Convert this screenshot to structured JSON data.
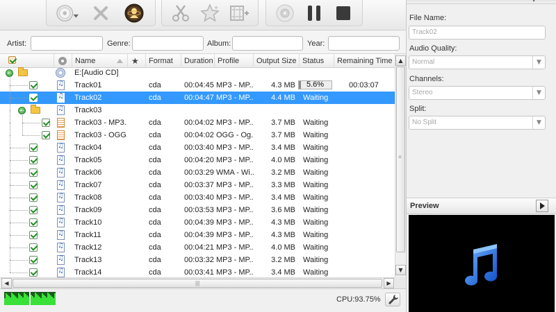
{
  "toolbar": {
    "groups": [
      {
        "buttons": [
          "cd-load-icon",
          "remove-icon",
          "profile-icon"
        ]
      },
      {
        "buttons": [
          "trim-icon",
          "effect-icon",
          "merge-icon"
        ]
      },
      {
        "buttons": [
          "snapshot-icon",
          "pause-icon",
          "stop-icon"
        ]
      }
    ]
  },
  "filters": {
    "artist_label": "Artist:",
    "artist_value": "",
    "genre_label": "Genre:",
    "genre_value": "",
    "album_label": "Album:",
    "album_value": "",
    "year_label": "Year:",
    "year_value": ""
  },
  "columns": {
    "name": "Name",
    "format": "Format",
    "duration": "Duration",
    "profile": "Profile",
    "output_size": "Output Size",
    "status": "Status",
    "remaining": "Remaining Time"
  },
  "rows": [
    {
      "kind": "disc",
      "name": "E:[Audio CD]"
    },
    {
      "kind": "track",
      "name": "Track01",
      "format": "cda",
      "duration": "00:04:45",
      "profile": "MP3 - MP...",
      "size": "4.3 MB",
      "status": "5.6%",
      "progress": 0.056,
      "remaining": "00:03:07"
    },
    {
      "kind": "track",
      "name": "Track02",
      "format": "cda",
      "duration": "00:04:47",
      "profile": "MP3 - MP...",
      "size": "4.4 MB",
      "status": "Waiting",
      "remaining": "",
      "selected": true
    },
    {
      "kind": "folder",
      "name": "Track03"
    },
    {
      "kind": "subtrack",
      "name": "Track03 - MP3...",
      "format": "cda",
      "duration": "00:04:02",
      "profile": "MP3 - MP...",
      "size": "3.7 MB",
      "status": "Waiting",
      "remaining": ""
    },
    {
      "kind": "subtrack",
      "name": "Track03 - OGG...",
      "format": "cda",
      "duration": "00:04:02",
      "profile": "OGG - Og...",
      "size": "3.7 MB",
      "status": "Waiting",
      "remaining": ""
    },
    {
      "kind": "track",
      "name": "Track04",
      "format": "cda",
      "duration": "00:03:40",
      "profile": "MP3 - MP...",
      "size": "3.4 MB",
      "status": "Waiting",
      "remaining": ""
    },
    {
      "kind": "track",
      "name": "Track05",
      "format": "cda",
      "duration": "00:04:20",
      "profile": "MP3 - MP...",
      "size": "4.0 MB",
      "status": "Waiting",
      "remaining": ""
    },
    {
      "kind": "track",
      "name": "Track06",
      "format": "cda",
      "duration": "00:03:29",
      "profile": "WMA - Wi...",
      "size": "3.2 MB",
      "status": "Waiting",
      "remaining": ""
    },
    {
      "kind": "track",
      "name": "Track07",
      "format": "cda",
      "duration": "00:03:37",
      "profile": "MP3 - MP...",
      "size": "3.3 MB",
      "status": "Waiting",
      "remaining": ""
    },
    {
      "kind": "track",
      "name": "Track08",
      "format": "cda",
      "duration": "00:03:40",
      "profile": "MP3 - MP...",
      "size": "3.4 MB",
      "status": "Waiting",
      "remaining": ""
    },
    {
      "kind": "track",
      "name": "Track09",
      "format": "cda",
      "duration": "00:03:53",
      "profile": "MP3 - MP...",
      "size": "3.6 MB",
      "status": "Waiting",
      "remaining": ""
    },
    {
      "kind": "track",
      "name": "Track10",
      "format": "cda",
      "duration": "00:04:39",
      "profile": "MP3 - MP...",
      "size": "4.3 MB",
      "status": "Waiting",
      "remaining": ""
    },
    {
      "kind": "track",
      "name": "Track11",
      "format": "cda",
      "duration": "00:04:39",
      "profile": "MP3 - MP...",
      "size": "4.3 MB",
      "status": "Waiting",
      "remaining": ""
    },
    {
      "kind": "track",
      "name": "Track12",
      "format": "cda",
      "duration": "00:04:21",
      "profile": "MP3 - MP...",
      "size": "4.0 MB",
      "status": "Waiting",
      "remaining": ""
    },
    {
      "kind": "track",
      "name": "Track13",
      "format": "cda",
      "duration": "00:03:32",
      "profile": "MP3 - MP...",
      "size": "3.2 MB",
      "status": "Waiting",
      "remaining": ""
    },
    {
      "kind": "track",
      "name": "Track14",
      "format": "cda",
      "duration": "00:03:41",
      "profile": "MP3 - MP...",
      "size": "3.4 MB",
      "status": "Waiting",
      "remaining": ""
    }
  ],
  "status_bar": {
    "cpu": "CPU:93.75%"
  },
  "right_panel": {
    "file_name_label": "File Name:",
    "file_name_value": "Track02",
    "audio_quality_label": "Audio Quality:",
    "audio_quality_value": "Normal",
    "channels_label": "Channels:",
    "channels_value": "Stereo",
    "split_label": "Split:",
    "split_value": "No Split",
    "preview_label": "Preview"
  },
  "colors": {
    "selection": "#3399ff",
    "accent_green": "#1c8f1c",
    "preview_note": "#2a7cff"
  }
}
